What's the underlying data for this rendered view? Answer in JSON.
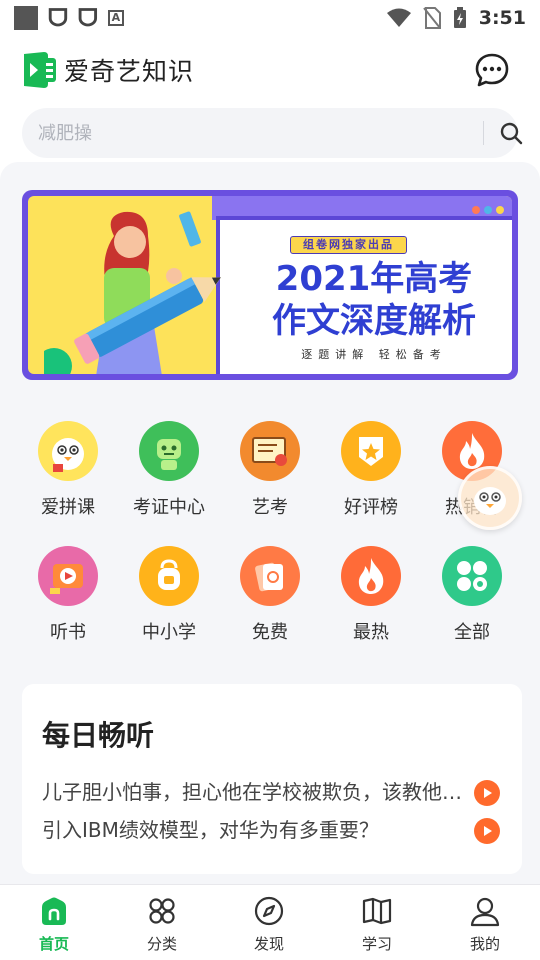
{
  "status_bar": {
    "time": "3:51"
  },
  "app": {
    "title": "爱奇艺知识",
    "brand_color": "#19b955"
  },
  "search": {
    "placeholder": "减肥操"
  },
  "banner": {
    "badge": "组卷网独家出品",
    "title_line1": "2021年高考",
    "title_line2": "作文深度解析",
    "subtitle": "逐题讲解  轻松备考"
  },
  "grid": {
    "row1": [
      {
        "label": "爱拼课",
        "icon": "pinke-mascot-icon"
      },
      {
        "label": "考证中心",
        "icon": "robot-icon"
      },
      {
        "label": "艺考",
        "icon": "certificate-icon"
      },
      {
        "label": "好评榜",
        "icon": "star-badge-icon"
      },
      {
        "label": "热销榜",
        "icon": "flame-icon"
      }
    ],
    "row2": [
      {
        "label": "听书",
        "icon": "audiobook-icon"
      },
      {
        "label": "中小学",
        "icon": "schoolbag-icon"
      },
      {
        "label": "免费",
        "icon": "free-ticket-icon"
      },
      {
        "label": "最热",
        "icon": "hot-flame-icon"
      },
      {
        "label": "全部",
        "icon": "all-grid-icon"
      }
    ]
  },
  "daily": {
    "title": "每日畅听",
    "items": [
      "儿子胆小怕事，担心他在学校被欺负，该教他…",
      "引入IBM绩效模型，对华为有多重要？"
    ]
  },
  "bottom_nav": [
    {
      "label": "首页",
      "icon": "home-icon",
      "active": true
    },
    {
      "label": "分类",
      "icon": "category-icon",
      "active": false
    },
    {
      "label": "发现",
      "icon": "compass-icon",
      "active": false
    },
    {
      "label": "学习",
      "icon": "book-icon",
      "active": false
    },
    {
      "label": "我的",
      "icon": "profile-icon",
      "active": false
    }
  ]
}
